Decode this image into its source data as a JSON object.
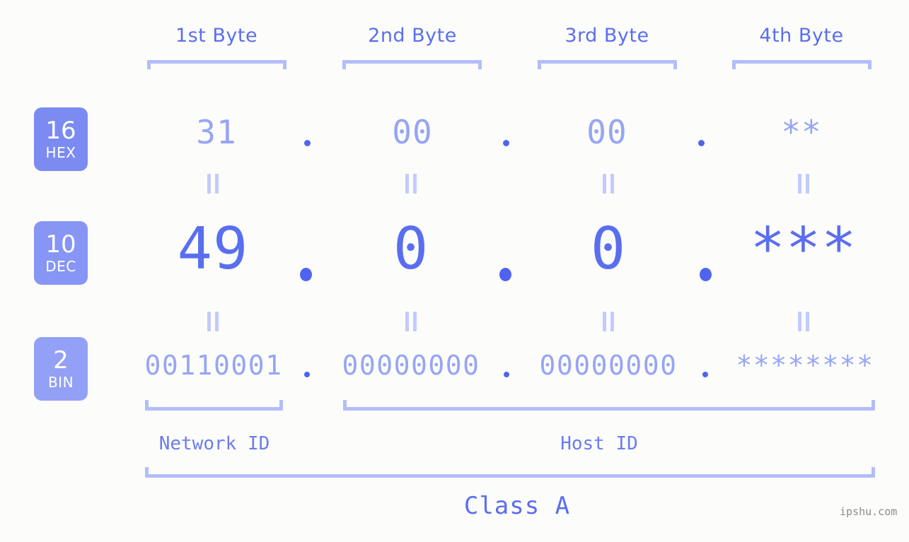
{
  "background_color": "#fcfdfa",
  "accent_color": "#5a6ef0",
  "accent_light_color": "#97a5f5",
  "bracket_color": "#b3bdfb",
  "badge_color": "#7b8bf2",
  "byte_headers": [
    {
      "label": "1st Byte"
    },
    {
      "label": "2nd Byte"
    },
    {
      "label": "3rd Byte"
    },
    {
      "label": "4th Byte"
    }
  ],
  "rows": [
    {
      "base_number": "16",
      "base_label": "HEX",
      "values": [
        "31",
        "00",
        "00",
        "**"
      ],
      "separator": "."
    },
    {
      "base_number": "10",
      "base_label": "DEC",
      "values": [
        "49",
        "0",
        "0",
        "***"
      ],
      "separator": "."
    },
    {
      "base_number": "2",
      "base_label": "BIN",
      "values": [
        "00110001",
        "00000000",
        "00000000",
        "********"
      ],
      "separator": "."
    }
  ],
  "connectors": {
    "symbol": "equals"
  },
  "id_labels": {
    "network": "Network ID",
    "host": "Host ID"
  },
  "class_label": "Class A",
  "watermark": "ipshu.com"
}
